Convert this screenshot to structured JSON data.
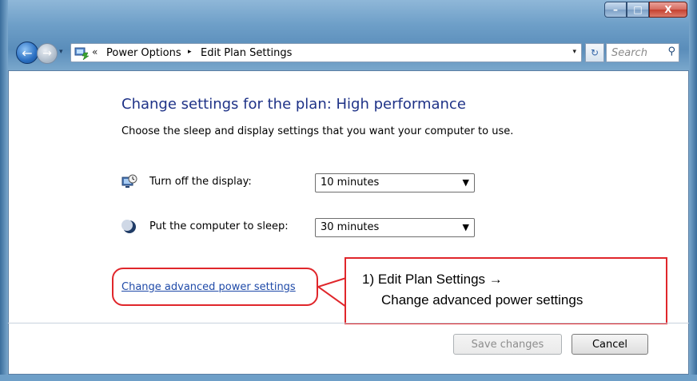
{
  "window": {
    "controls": {
      "minimize": "–",
      "maximize": "□",
      "close": "X"
    }
  },
  "nav": {
    "back_glyph": "←",
    "forward_glyph": "→",
    "history_glyph": "▾",
    "address_icon": "power-options-icon",
    "overflow_glyph": "«",
    "breadcrumbs": [
      "Power Options",
      "Edit Plan Settings"
    ],
    "separator_glyph": "▸",
    "address_dropdown_glyph": "▾",
    "refresh_glyph": "↻",
    "search_placeholder": "Search",
    "search_icon_glyph": "⚲"
  },
  "content": {
    "title": "Change settings for the plan: High performance",
    "subtitle": "Choose the sleep and display settings that you want your computer to use.",
    "settings": [
      {
        "icon": "display-icon",
        "label": "Turn off the display:",
        "value": "10 minutes"
      },
      {
        "icon": "sleep-moon-icon",
        "label": "Put the computer to sleep:",
        "value": "30 minutes"
      }
    ],
    "dropdown_arrow": "▼",
    "advanced_link": "Change advanced power settings"
  },
  "annotation": {
    "line1": "1) Edit Plan Settings →",
    "line2": "Change advanced power settings",
    "color": "#e0262b"
  },
  "footer": {
    "save_label": "Save changes",
    "save_enabled": false,
    "cancel_label": "Cancel"
  }
}
